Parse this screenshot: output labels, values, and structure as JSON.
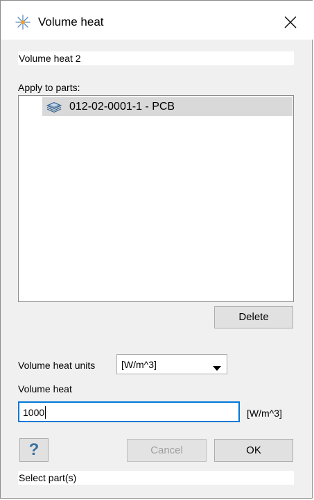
{
  "window": {
    "title": "Volume heat",
    "icon": "sparkle-icon"
  },
  "name_field": {
    "value": "Volume heat 2"
  },
  "apply": {
    "label": "Apply to parts:",
    "parts": [
      {
        "label": "012-02-0001-1 - PCB",
        "icon": "layers-icon"
      }
    ]
  },
  "buttons": {
    "delete": "Delete",
    "cancel": "Cancel",
    "ok": "OK",
    "help": "?"
  },
  "units": {
    "label": "Volume heat units",
    "selected": "[W/m^3]"
  },
  "heat": {
    "label": "Volume heat",
    "value": "1000",
    "unit": "[W/m^3]"
  },
  "status": {
    "text": "Select part(s)"
  }
}
